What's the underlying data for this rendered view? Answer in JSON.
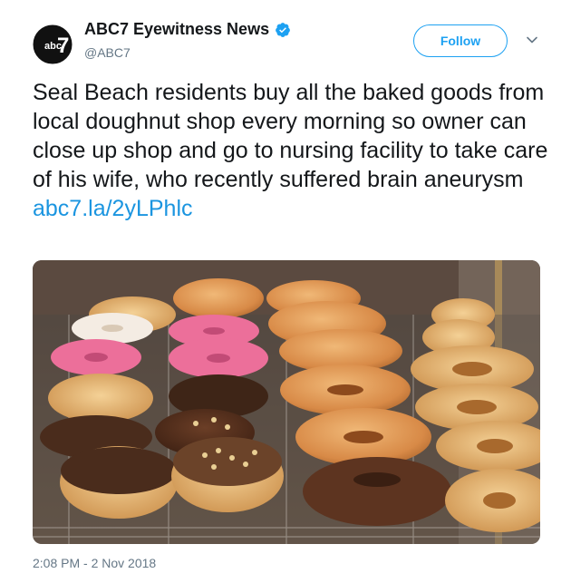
{
  "account": {
    "display_name": "ABC7 Eyewitness News",
    "handle": "@ABC7",
    "avatar_text": "abc",
    "avatar_number": "7",
    "verified": true
  },
  "follow_button": {
    "label": "Follow"
  },
  "tweet": {
    "text": "Seal Beach residents buy all the baked goods from local doughnut shop every morning so owner can close up shop and go to nursing facility to take care of his wife, who recently suffered brain aneurysm",
    "link": "abc7.la/2yLPhlc"
  },
  "photo": {
    "subject": "doughnuts in a bakery display case"
  },
  "timestamp": "2:08 PM - 2 Nov 2018",
  "colors": {
    "accent": "#1da1f2",
    "link": "#1b95e0",
    "text": "#14171a",
    "muted": "#657786"
  },
  "icons": [
    "abc7-logo-icon",
    "verified-badge-icon",
    "chevron-down-icon"
  ]
}
